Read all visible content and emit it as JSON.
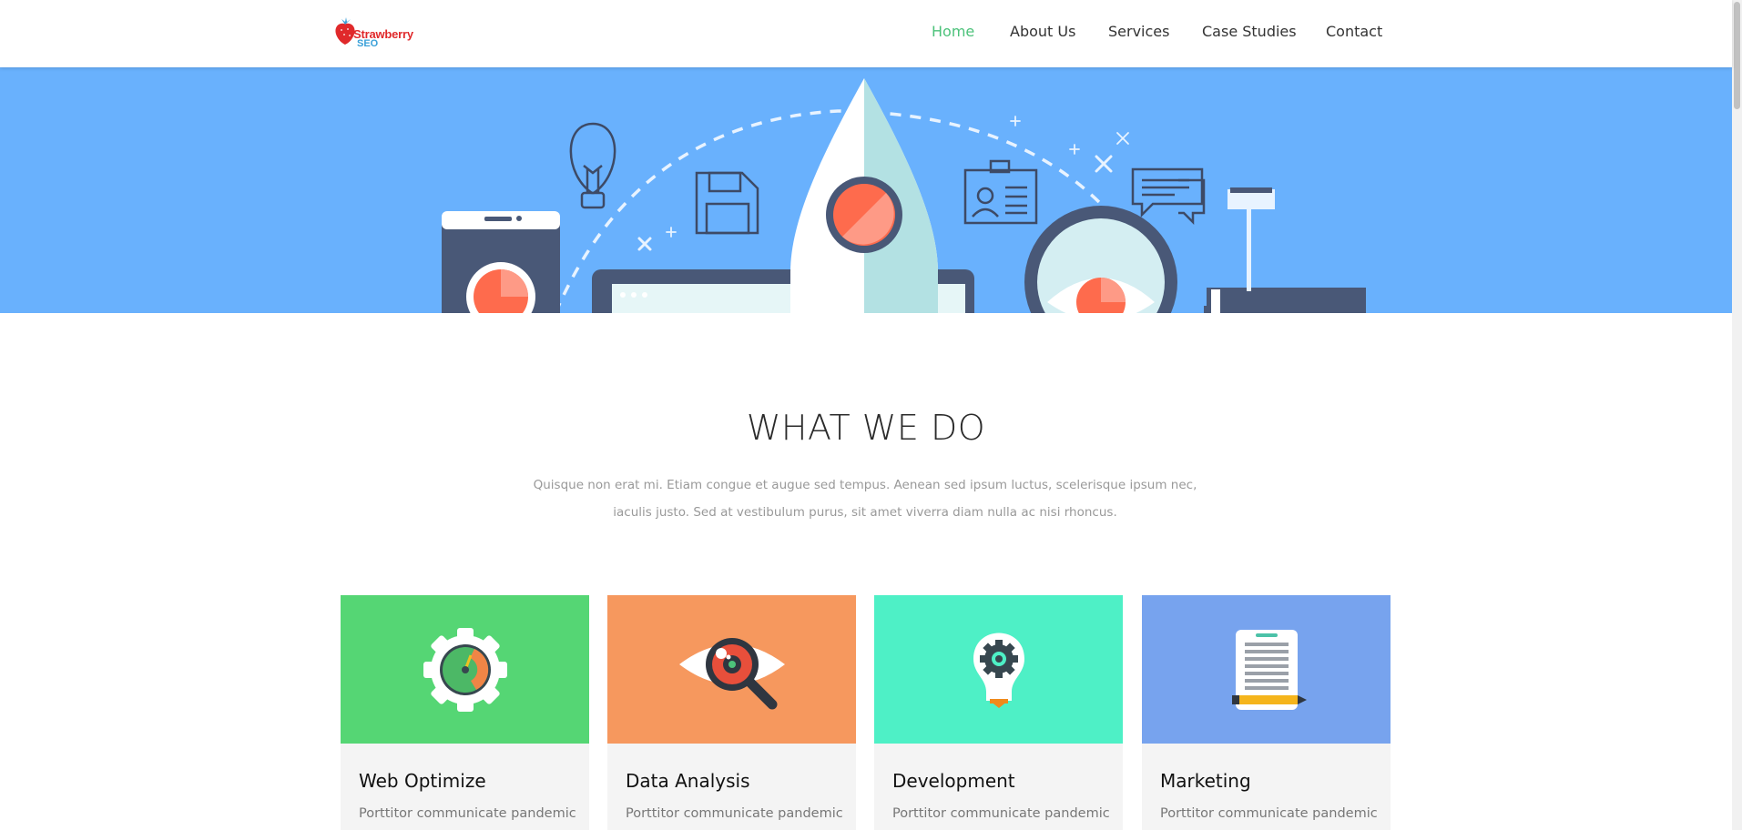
{
  "brand": {
    "logo_line1": "Strawberry",
    "logo_line2": "SEO"
  },
  "nav": {
    "items": [
      {
        "label": "Home",
        "active": true
      },
      {
        "label": "About Us"
      },
      {
        "label": "Services"
      },
      {
        "label": "Case Studies"
      },
      {
        "label": "Contact"
      }
    ]
  },
  "colors": {
    "accent": "#4cc27a",
    "hero_bg": "#69b1fd",
    "card_green": "#55d674",
    "card_orange": "#f6985e",
    "card_teal": "#4ef0c6",
    "card_blue": "#77a3ee"
  },
  "section": {
    "title": "WHAT WE DO",
    "desc_line1": "Quisque non erat mi. Etiam congue et augue sed tempus. Aenean sed ipsum luctus, scelerisque ipsum nec,",
    "desc_line2": "iaculis justo. Sed at vestibulum purus, sit amet viverra diam nulla ac nisi rhoncus."
  },
  "cards": [
    {
      "title": "Web Optimize",
      "text": "Porttitor communicate pandemic",
      "icon": "speedometer-gear-icon"
    },
    {
      "title": "Data Analysis",
      "text": "Porttitor communicate pandemic",
      "icon": "eye-magnifier-icon"
    },
    {
      "title": "Development",
      "text": "Porttitor communicate pandemic",
      "icon": "lightbulb-gear-icon"
    },
    {
      "title": "Marketing",
      "text": "Porttitor communicate pandemic",
      "icon": "document-pencil-icon"
    }
  ]
}
